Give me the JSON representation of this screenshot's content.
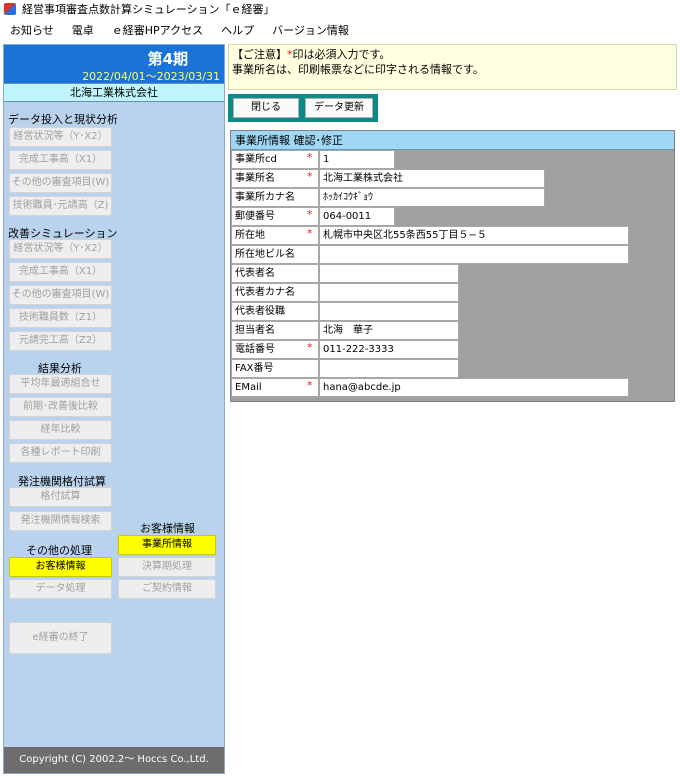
{
  "window": {
    "title": "経営事項審査点数計算シミュレーション「ｅ経審」"
  },
  "menu": [
    "お知らせ",
    "電卓",
    "ｅ経審HPアクセス",
    "ヘルプ",
    "バージョン情報"
  ],
  "period": {
    "label": "第4期",
    "range": "2022/04/01〜2023/03/31"
  },
  "company": "北海工業株式会社",
  "sections": {
    "data_input": "データ投入と現状分析",
    "improve": "改善シミュレーション",
    "results": "結果分析",
    "orderer": "発注機関格付試算",
    "customer": "お客様情報",
    "other": "その他の処理"
  },
  "buttons": {
    "keiei": "経営状況等（Y･X2）",
    "kansei": "完成工事高（X1）",
    "sonota": "その他の審査項目(W)",
    "gijutsu": "技術職員･元請高（Z)",
    "keiei2": "経営状況等（Y･X2）",
    "kansei2": "完成工事高（X1）",
    "sonota2": "その他の審査項目(W)",
    "gijutsu_su": "技術職員数（Z1）",
    "motouke": "元請完工高（Z2）",
    "heikin": "平均年最適組合せ",
    "zengo": "前期･改善後比較",
    "keinen": "経年比較",
    "report": "各種レポート印刷",
    "kakuzuke": "格付試算",
    "hatchu": "発注機関情報検索",
    "jigyosho": "事業所情報",
    "okyaku": "お客様情報",
    "kessan": "決算期処理",
    "data_shori": "データ処理",
    "keiyaku": "ご契約情報",
    "end": "e経審の終了"
  },
  "footer": "Copyright (C)  2002.2〜 Hoccs Co.,Ltd.",
  "notice": {
    "line1_prefix": "【ご注意】",
    "line1_star": "*",
    "line1_rest": "印は必須入力です。",
    "line2": "事業所名は、印刷帳票などに印字される情報です。"
  },
  "toolbar": {
    "close": "閉じる",
    "update": "データ更新"
  },
  "form": {
    "header": "事業所情報  確認･修正",
    "fields": [
      {
        "label": "事業所cd",
        "required": true,
        "value": "1"
      },
      {
        "label": "事業所名",
        "required": true,
        "value": "北海工業株式会社"
      },
      {
        "label": "事業所カナ名",
        "required": false,
        "value": "ﾎｯｶｲｺｳｷﾞｮｳ"
      },
      {
        "label": "郵便番号",
        "required": true,
        "value": "064-0011"
      },
      {
        "label": "所在地",
        "required": true,
        "value": "札幌市中央区北55条西55丁目５−５"
      },
      {
        "label": "所在地ビル名",
        "required": false,
        "value": ""
      },
      {
        "label": "代表者名",
        "required": false,
        "value": ""
      },
      {
        "label": "代表者カナ名",
        "required": false,
        "value": ""
      },
      {
        "label": "代表者役職",
        "required": false,
        "value": ""
      },
      {
        "label": "担当者名",
        "required": false,
        "value": "北海　華子"
      },
      {
        "label": "電話番号",
        "required": true,
        "value": "011-222-3333"
      },
      {
        "label": "FAX番号",
        "required": false,
        "value": ""
      },
      {
        "label": "EMail",
        "required": true,
        "value": "hana@abcde.jp"
      }
    ],
    "star": "*"
  }
}
